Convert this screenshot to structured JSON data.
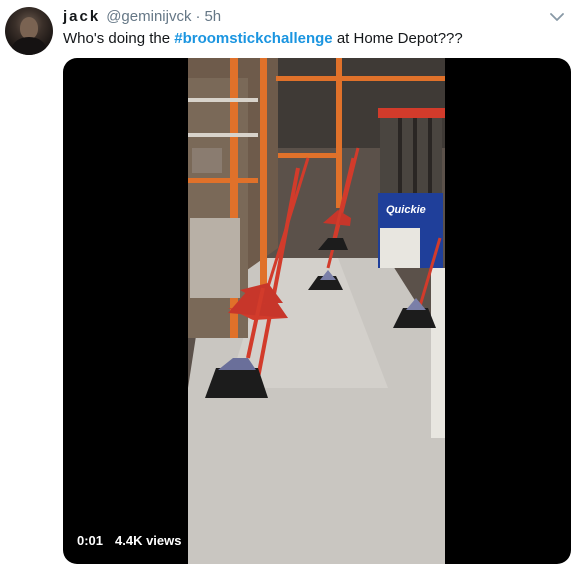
{
  "tweet": {
    "author_name": "jack",
    "author_handle": "@geminijvck",
    "separator": "·",
    "timestamp": "5h",
    "text_before": "Who's doing the ",
    "hashtag": "#broomstickchallenge",
    "text_after": " at Home Depot???",
    "hashtag_color": "#1b95e0"
  },
  "media": {
    "duration": "0:01",
    "views": "4.4K views",
    "sign_text": "Quickie"
  },
  "icons": {
    "menu": "chevron-down-icon",
    "avatar": "avatar"
  }
}
